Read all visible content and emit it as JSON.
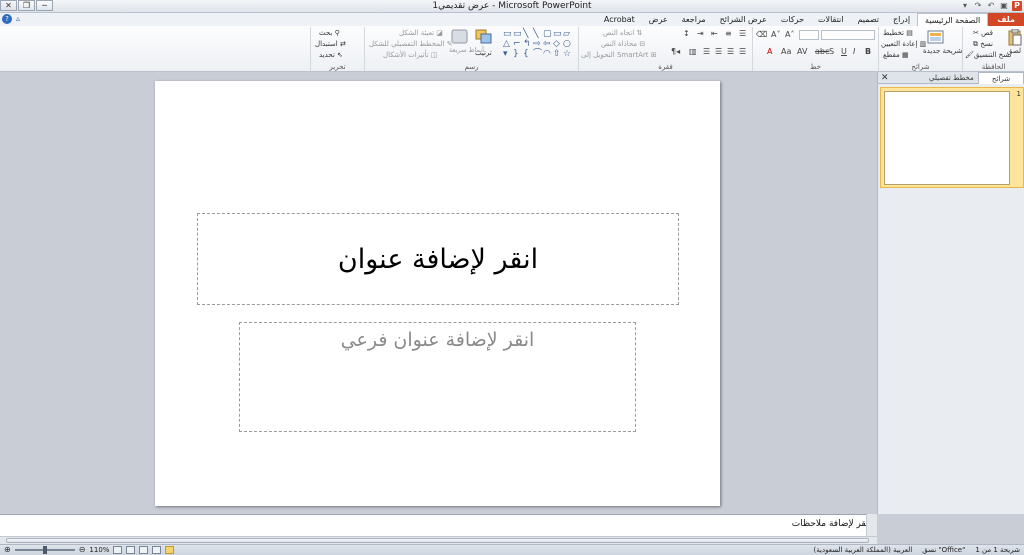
{
  "window": {
    "title": "عرض تقديمي1 - Microsoft PowerPoint"
  },
  "ribbon_tabs": [
    {
      "label": "ملف",
      "kind": "file"
    },
    {
      "label": "الصفحة الرئيسية",
      "kind": "active"
    },
    {
      "label": "إدراج",
      "kind": ""
    },
    {
      "label": "تصميم",
      "kind": ""
    },
    {
      "label": "انتقالات",
      "kind": ""
    },
    {
      "label": "حركات",
      "kind": ""
    },
    {
      "label": "عرض الشرائح",
      "kind": ""
    },
    {
      "label": "مراجعة",
      "kind": ""
    },
    {
      "label": "عرض",
      "kind": ""
    },
    {
      "label": "Acrobat",
      "kind": ""
    }
  ],
  "ribbon": {
    "clipboard": {
      "label": "الحافظة",
      "paste": "لصق",
      "cut": "قص",
      "copy": "نسخ",
      "format_painter": "نسخ التنسيق"
    },
    "slides": {
      "label": "شرائح",
      "new_slide": "شريحة جديدة",
      "layout": "تخطيط",
      "reset": "إعادة التعيين",
      "section": "مقطع"
    },
    "font": {
      "label": "خط"
    },
    "paragraph": {
      "label": "فقرة",
      "text_direction": "اتجاه النص",
      "align_text": "محاذاة النص",
      "convert_smartart": "التحويل إلى SmartArt"
    },
    "drawing": {
      "label": "رسم",
      "arrange": "ترتيب",
      "quick_styles": "أنماط سريعة",
      "shape_fill": "تعبئة الشكل",
      "shape_outline": "المخطط التفصيلي للشكل",
      "shape_effects": "تأثيرات الأشكال"
    },
    "editing": {
      "label": "تحرير",
      "find": "بحث",
      "replace": "استبدال",
      "select": "تحديد"
    }
  },
  "left_pane": {
    "tab_slides": "شرائح",
    "tab_outline": "مخطط تفصيلي",
    "close": "✕",
    "thumbnails": [
      {
        "number": "1"
      }
    ]
  },
  "slide": {
    "title_placeholder": "انقر لإضافة عنوان",
    "subtitle_placeholder": "انقر لإضافة عنوان فرعي"
  },
  "notes": {
    "placeholder": "انقر لإضافة ملاحظات"
  },
  "status": {
    "slide_info": "شريحة 1 من 1",
    "theme": "\"Office\" نسق",
    "language": "العربية (المملكة العربية السعودية)",
    "zoom": "110%",
    "zoom_fraction": 0.5
  },
  "colors": {
    "file_tab": "#d24726",
    "selected_thumb": "#fce49a"
  }
}
